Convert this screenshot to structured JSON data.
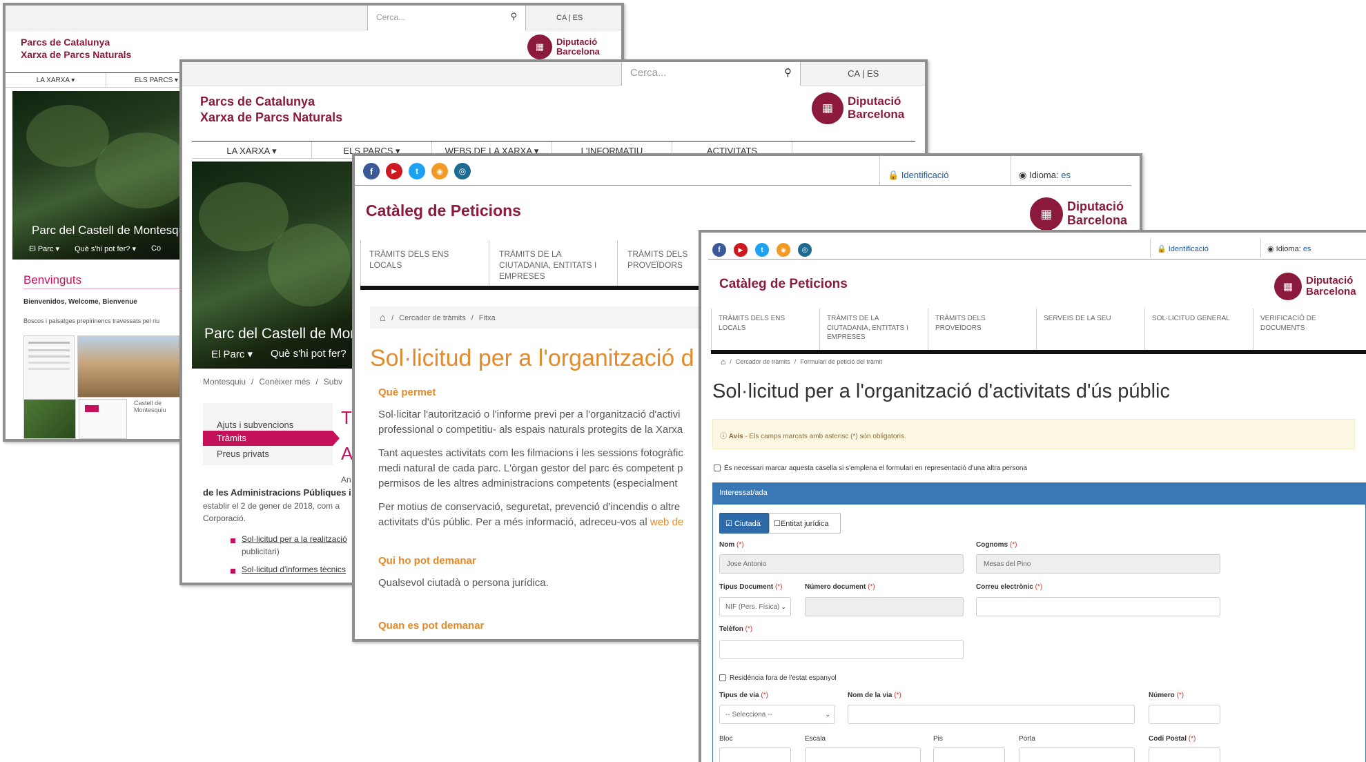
{
  "brand": {
    "line1": "Parcs de Catalunya",
    "line2": "Xarxa de Parcs Naturals",
    "dip_line1": "Diputació",
    "dip_line2": "Barcelona",
    "crimson": "#8b1a3c"
  },
  "search": {
    "placeholder": "Cerca..."
  },
  "lang": {
    "ca": "CA",
    "sep": "|",
    "es": "ES"
  },
  "w1": {
    "nav": [
      "LA XARXA ▾",
      "ELS PARCS ▾"
    ],
    "hero_title": "Parc del Castell de Montesquiu",
    "hero_links": [
      "El Parc ▾",
      "Què s'hi pot fer? ▾",
      "Co"
    ],
    "welcome": "Benvinguts",
    "greeting": "Bienvenidos, Welcome, Bienvenue",
    "desc": "Boscos i paisatges prepirinencs travessats pel riu",
    "thumb_caption": "Castell de Montesquiu"
  },
  "w2": {
    "nav": [
      "LA XARXA ▾",
      "ELS PARCS ▾",
      "WEBS DE LA XARXA ▾",
      "L'INFORMATIU",
      "ACTIVITATS"
    ],
    "hero_title": "Parc del Castell de Montesquiu",
    "hero_links": [
      "El Parc ▾",
      "Què s'hi pot fer?"
    ],
    "breadcrumb": [
      "Montesquiu",
      "/",
      "Conèixer més",
      "/",
      "Subv"
    ],
    "side": [
      "Ajuts i subvencions",
      "Tràmits",
      "Preus privats"
    ],
    "body_line1": "de les Administracions Públiques i",
    "body_line2": "establir el 2 de gener de 2018, com a",
    "body_line3": "Corporació.",
    "list": [
      "Sol·licitud per a la realització",
      "publicitari)",
      "Sol·licitud d'informes tècnics"
    ],
    "big_letters": [
      "T",
      "A"
    ],
    "an": "An"
  },
  "w3": {
    "social": [
      "f",
      "▶",
      "t",
      "◉",
      "◎"
    ],
    "identificacio": "Identificació",
    "idioma_label": "Idioma:",
    "idioma_value": "es",
    "title": "Catàleg de Peticions",
    "tabs": [
      "TRÀMITS DELS ENS LOCALS",
      "TRÀMITS DE LA CIUTADANIA, ENTITATS I EMPRESES",
      "TRÀMITS DELS PROVEÏDORS"
    ],
    "breadcrumb": [
      "Cercador de tràmits",
      "/",
      "Fitxa"
    ],
    "heading": "Sol·licitud per a l'organització d",
    "h_que_permet": "Què permet",
    "p1a": "Sol·licitar l'autorització o l'informe previ per a l'organització d'activi",
    "p1b": "professional o competitiu- als espais naturals protegits de la Xarxa",
    "p2a": "Tant aquestes activitats com les filmacions i les sessions fotogràfic",
    "p2b": "medi natural de cada parc. L'òrgan gestor del parc és competent p",
    "p2c": "permisos de les altres administracions competents (especialment",
    "p3a": "Per motius de conservació, seguretat, prevenció d'incendis o altre",
    "p3b": "activitats d'ús públic. Per a més informació, adreceu-vos al",
    "p3link": "web de",
    "h_qui": "Qui ho pot demanar",
    "qui_text": "Qualsevol ciutadà o persona jurídica.",
    "h_quan": "Quan es pot demanar"
  },
  "w4": {
    "social": [
      "f",
      "▶",
      "t",
      "◉",
      "◎"
    ],
    "identificacio": "Identificació",
    "idioma_label": "Idioma:",
    "idioma_value": "es",
    "title": "Catàleg de Peticions",
    "tabs": [
      "TRÀMITS DELS ENS LOCALS",
      "TRÀMITS DE LA CIUTADANIA, ENTITATS I EMPRESES",
      "TRÀMITS DELS PROVEÏDORS",
      "SERVEIS DE LA SEU",
      "SOL·LICITUD GENERAL",
      "VERIFICACIÓ DE DOCUMENTS"
    ],
    "breadcrumb": [
      "Cercador de tràmits",
      "/",
      "Formulari de petició del tràmit"
    ],
    "heading": "Sol·licitud per a l'organització d'activitats d'ús públic",
    "notice_label": "Avís",
    "notice_text": " - Els camps marcats amb asterisc (*) són obligatoris.",
    "represent": "És necessari marcar aquesta casella si s'emplena el formulari en representació d'una altra persona",
    "panel": "Interessat/ada",
    "btn_ciutada": "Ciutadà",
    "btn_entitat": "Entitat jurídica",
    "req": "(*)",
    "nom_label": "Nom",
    "nom_value": "Jose Antonio",
    "cognoms_label": "Cognoms",
    "cognoms_value": "Mesas del Pino",
    "tipus_doc_label": "Tipus Document",
    "tipus_doc_value": "NIF (Pers. Física)",
    "num_doc_label": "Número document",
    "correu_label": "Correu electrònic",
    "telefon_label": "Telèfon",
    "residencia": "Residència fora de l'estat espanyol",
    "tipus_via_label": "Tipus de via",
    "tipus_via_value": "-- Selecciona --",
    "nom_via_label": "Nom de la via",
    "numero_label": "Número",
    "bloc_label": "Bloc",
    "escala_label": "Escala",
    "pis_label": "Pis",
    "porta_label": "Porta",
    "cp_label": "Codi Postal"
  }
}
